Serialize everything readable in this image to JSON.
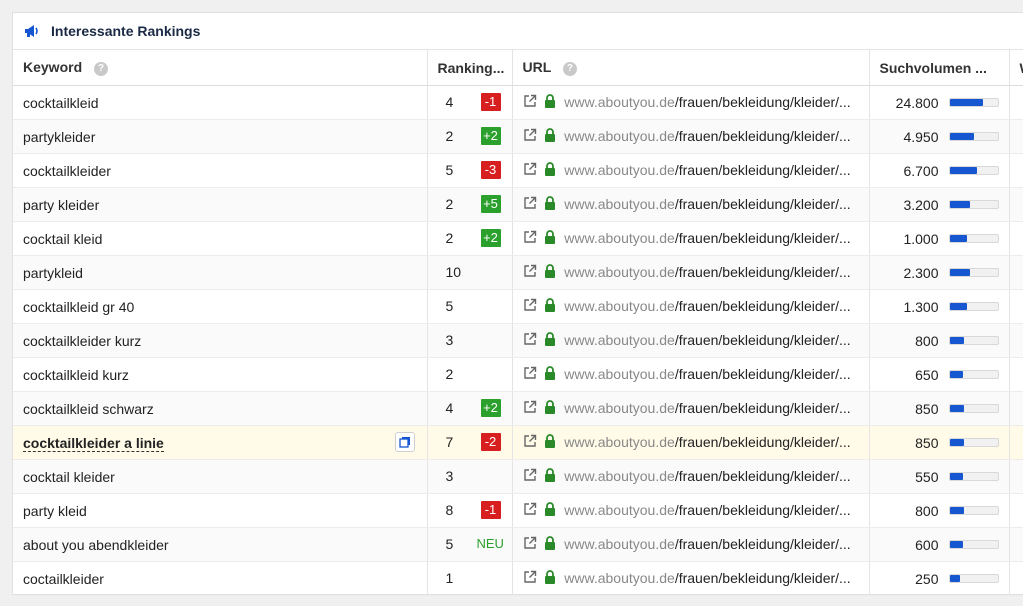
{
  "panel": {
    "title": "Interessante Rankings",
    "icon": "megaphone-icon"
  },
  "columns": {
    "keyword": "Keyword",
    "ranking": "Ranking...",
    "url": "URL",
    "volume": "Suchvolumen ...",
    "extra": "W"
  },
  "accent_color": "#1656d1",
  "rows": [
    {
      "keyword": "cocktailkleid",
      "rank": "4",
      "change": "-1",
      "change_type": "neg",
      "domain": "www.aboutyou.de",
      "path": "/frauen/bekleidung/kleider/...",
      "volume": "24.800",
      "volume_fill": 0.7
    },
    {
      "keyword": "partykleider",
      "rank": "2",
      "change": "+2",
      "change_type": "pos",
      "domain": "www.aboutyou.de",
      "path": "/frauen/bekleidung/kleider/...",
      "volume": "4.950",
      "volume_fill": 0.5
    },
    {
      "keyword": "cocktailkleider",
      "rank": "5",
      "change": "-3",
      "change_type": "neg",
      "domain": "www.aboutyou.de",
      "path": "/frauen/bekleidung/kleider/...",
      "volume": "6.700",
      "volume_fill": 0.58
    },
    {
      "keyword": "party kleider",
      "rank": "2",
      "change": "+5",
      "change_type": "pos",
      "domain": "www.aboutyou.de",
      "path": "/frauen/bekleidung/kleider/...",
      "volume": "3.200",
      "volume_fill": 0.42
    },
    {
      "keyword": "cocktail kleid",
      "rank": "2",
      "change": "+2",
      "change_type": "pos",
      "domain": "www.aboutyou.de",
      "path": "/frauen/bekleidung/kleider/...",
      "volume": "1.000",
      "volume_fill": 0.36
    },
    {
      "keyword": "partykleid",
      "rank": "10",
      "change": "",
      "change_type": "none",
      "domain": "www.aboutyou.de",
      "path": "/frauen/bekleidung/kleider/...",
      "volume": "2.300",
      "volume_fill": 0.42
    },
    {
      "keyword": "cocktailkleid gr 40",
      "rank": "5",
      "change": "",
      "change_type": "none",
      "domain": "www.aboutyou.de",
      "path": "/frauen/bekleidung/kleider/...",
      "volume": "1.300",
      "volume_fill": 0.36
    },
    {
      "keyword": "cocktailkleider kurz",
      "rank": "3",
      "change": "",
      "change_type": "none",
      "domain": "www.aboutyou.de",
      "path": "/frauen/bekleidung/kleider/...",
      "volume": "800",
      "volume_fill": 0.3
    },
    {
      "keyword": "cocktailkleid kurz",
      "rank": "2",
      "change": "",
      "change_type": "none",
      "domain": "www.aboutyou.de",
      "path": "/frauen/bekleidung/kleider/...",
      "volume": "650",
      "volume_fill": 0.28
    },
    {
      "keyword": "cocktailkleid schwarz",
      "rank": "4",
      "change": "+2",
      "change_type": "pos",
      "domain": "www.aboutyou.de",
      "path": "/frauen/bekleidung/kleider/...",
      "volume": "850",
      "volume_fill": 0.3
    },
    {
      "keyword": "cocktailkleider a linie",
      "rank": "7",
      "change": "-2",
      "change_type": "neg",
      "domain": "www.aboutyou.de",
      "path": "/frauen/bekleidung/kleider/...",
      "volume": "850",
      "volume_fill": 0.3,
      "highlight": true
    },
    {
      "keyword": "cocktail kleider",
      "rank": "3",
      "change": "",
      "change_type": "none",
      "domain": "www.aboutyou.de",
      "path": "/frauen/bekleidung/kleider/...",
      "volume": "550",
      "volume_fill": 0.28
    },
    {
      "keyword": "party kleid",
      "rank": "8",
      "change": "-1",
      "change_type": "neg",
      "domain": "www.aboutyou.de",
      "path": "/frauen/bekleidung/kleider/...",
      "volume": "800",
      "volume_fill": 0.3
    },
    {
      "keyword": "about you abendkleider",
      "rank": "5",
      "change": "NEU",
      "change_type": "new",
      "domain": "www.aboutyou.de",
      "path": "/frauen/bekleidung/kleider/...",
      "volume": "600",
      "volume_fill": 0.28
    },
    {
      "keyword": "coctailkleider",
      "rank": "1",
      "change": "",
      "change_type": "none",
      "domain": "www.aboutyou.de",
      "path": "/frauen/bekleidung/kleider/...",
      "volume": "250",
      "volume_fill": 0.22
    }
  ]
}
